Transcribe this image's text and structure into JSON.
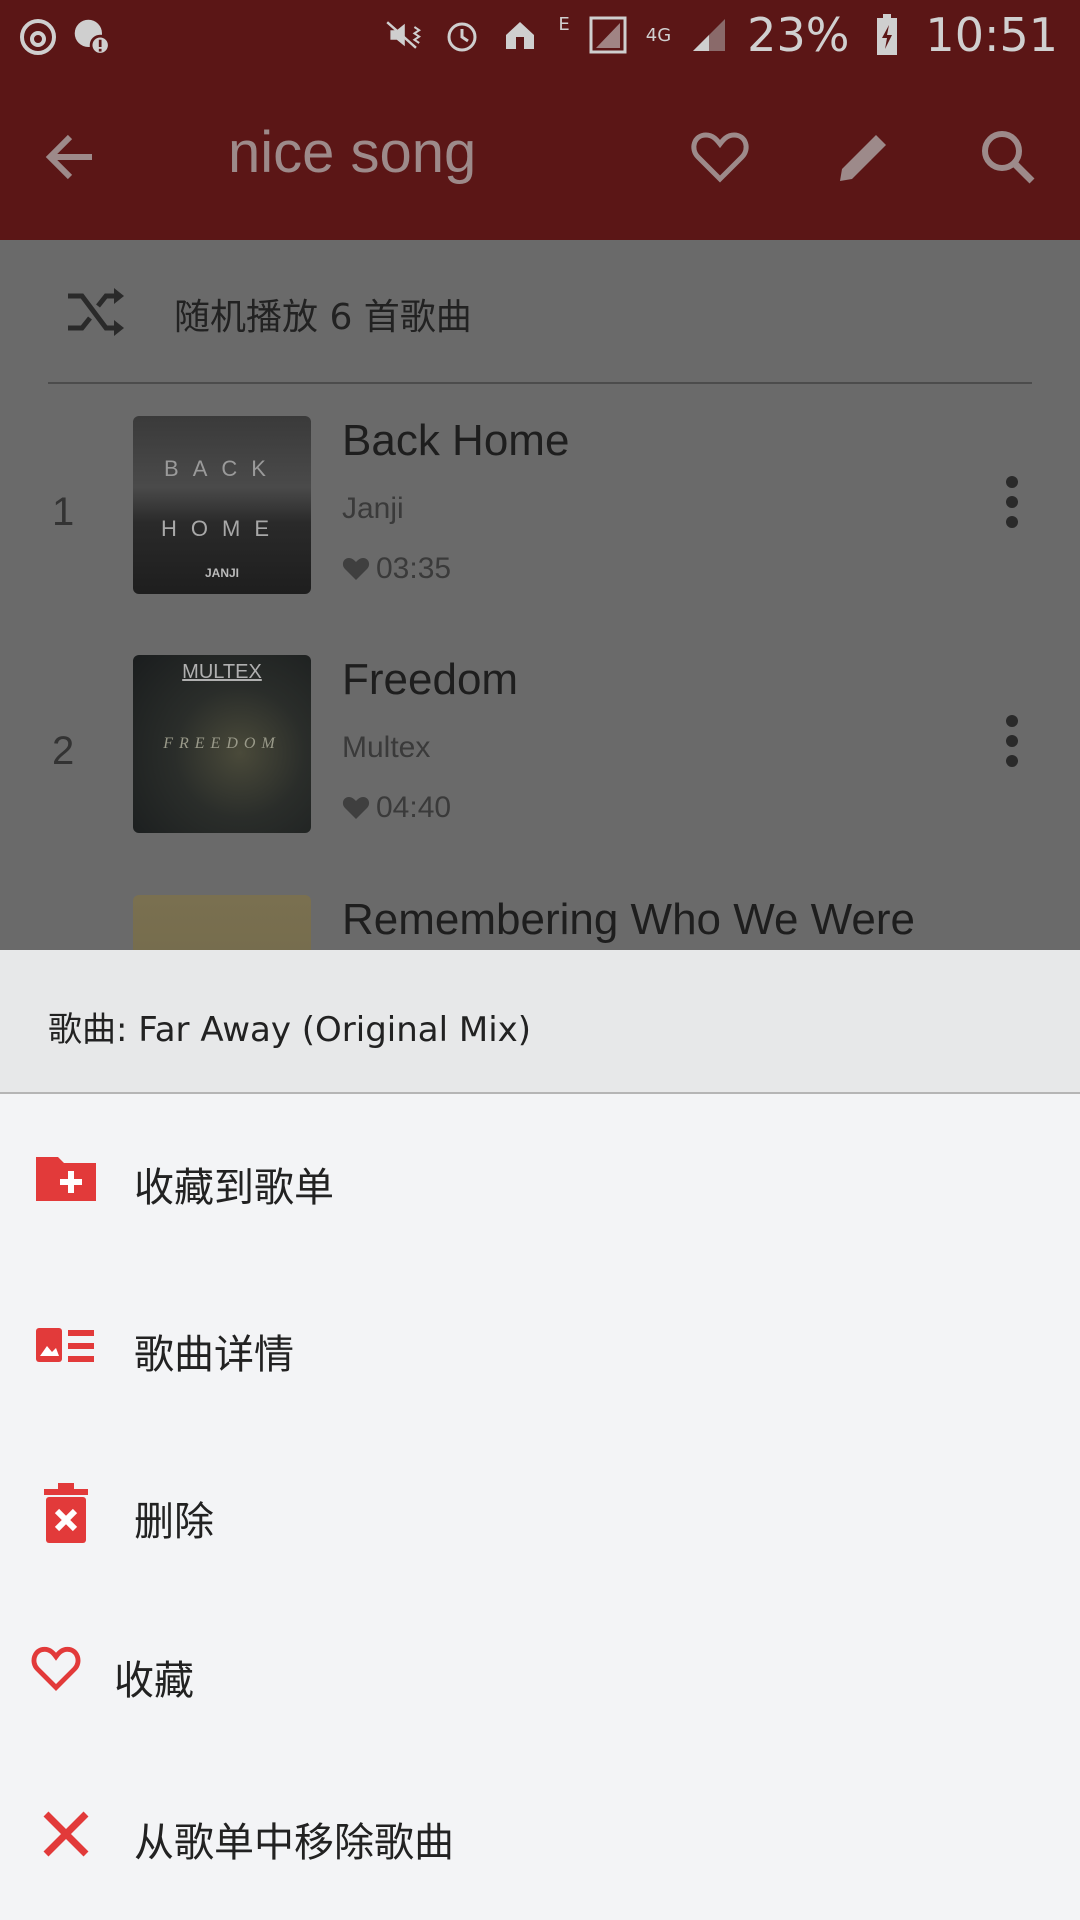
{
  "status_bar": {
    "battery": "23%",
    "time": "10:51",
    "network_e": "E",
    "network_4g": "4G"
  },
  "toolbar": {
    "title": "nice song"
  },
  "playlist": {
    "shuffle_label": "随机播放 6 首歌曲",
    "songs": [
      {
        "number": "1",
        "title": "Back Home",
        "artist": "Janji",
        "duration": "03:35",
        "cover_text_top": "BACK",
        "cover_text_bottom": "HOME",
        "cover_brand": "JANJI"
      },
      {
        "number": "2",
        "title": "Freedom",
        "artist": "Multex",
        "duration": "04:40",
        "cover_text_top": "MULTEX",
        "cover_text_bottom": "FREEDOM"
      },
      {
        "number": "",
        "title": "Remembering Who We Were"
      }
    ]
  },
  "sheet": {
    "header": "歌曲: Far Away (Original Mix)",
    "items": [
      {
        "label": "收藏到歌单",
        "icon": "folder-add-icon"
      },
      {
        "label": "歌曲详情",
        "icon": "details-icon"
      },
      {
        "label": "删除",
        "icon": "trash-icon"
      },
      {
        "label": "收藏",
        "icon": "heart-icon"
      },
      {
        "label": "从歌单中移除歌曲",
        "icon": "close-icon"
      }
    ]
  },
  "colors": {
    "toolbar_bg": "#5b1616",
    "accent_red": "#e23a3a",
    "dim_overlay": "#6a6a6a"
  }
}
